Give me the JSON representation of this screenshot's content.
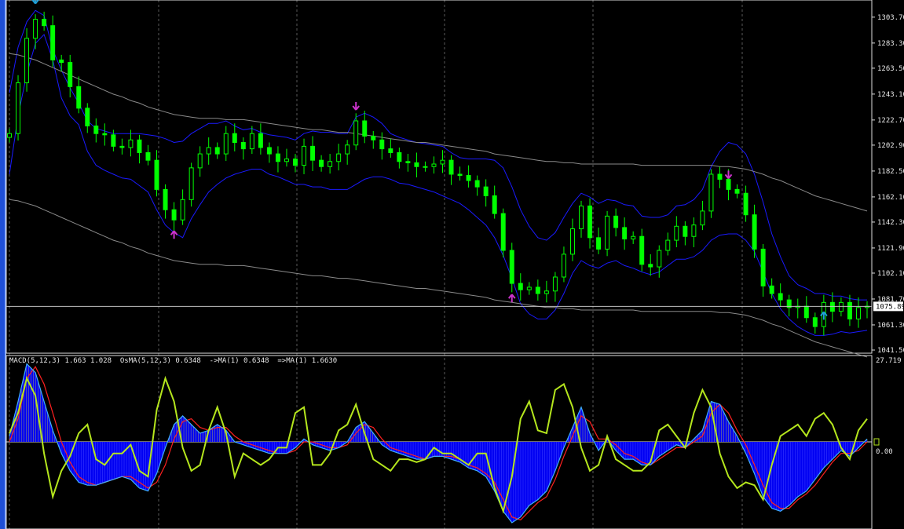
{
  "window": {
    "macd_label": "MACD(5,12,3) 1.663 1.028  OsMA(5,12,3) 0.6348  ->MA(1) 0.6348  =>MA(1) 1.6630"
  },
  "colors": {
    "background": "#000000",
    "candle_up": "#00ff00",
    "bollinger": "#1a1aff",
    "long_band": "#8a8a8a",
    "arrow_sell": "#cc33cc",
    "arrow_buy": "#1f9fd6",
    "osma_fill": "#0000ff",
    "macd_signal": "#ff2020",
    "macd_line": "#3fb0ff",
    "oscillator": "#b5e61d",
    "axis_text": "#e8e8e8"
  },
  "chart_data": [
    {
      "type": "line",
      "name": "price-panel",
      "ylim": [
        1041.5,
        1313.5
      ],
      "y_ticks": [
        "1303.70",
        "1283.30",
        "1263.50",
        "1243.10",
        "1222.70",
        "1202.90",
        "1182.50",
        "1162.10",
        "1142.30",
        "1121.90",
        "1102.10",
        "1081.70",
        "1061.30",
        "1041.50"
      ],
      "y_tick_values": [
        1303.7,
        1283.3,
        1263.5,
        1243.1,
        1222.7,
        1202.9,
        1182.5,
        1162.1,
        1142.3,
        1121.9,
        1102.1,
        1081.7,
        1061.3,
        1041.5
      ],
      "current_price": "1075.89",
      "current_price_value": 1075.89,
      "grid": "vertical-dotted",
      "series": [
        {
          "values": [
            1212,
            1252,
            1287,
            1302,
            1297,
            1270,
            1268,
            1249,
            1232,
            1218,
            1212,
            1211,
            1202,
            1201,
            1207,
            1197,
            1191,
            1168,
            1152,
            1144,
            1160,
            1185,
            1196,
            1201,
            1196,
            1212,
            1205,
            1200,
            1212,
            1201,
            1196,
            1190,
            1192,
            1187,
            1202,
            1191,
            1186,
            1190,
            1196,
            1203,
            1222,
            1210,
            1207,
            1200,
            1197,
            1190,
            1189,
            1186,
            1186,
            1188,
            1191,
            1180,
            1179,
            1175,
            1170,
            1163,
            1149,
            1120,
            1094,
            1089,
            1091,
            1086,
            1088,
            1099,
            1117,
            1137,
            1155,
            1130,
            1121,
            1147,
            1138,
            1129,
            1131,
            1109,
            1107,
            1120,
            1128,
            1139,
            1131,
            1140,
            1151,
            1180,
            1176,
            1168,
            1165,
            1148,
            1121,
            1092,
            1086,
            1081,
            1075,
            1076,
            1067,
            1060,
            1079,
            1072,
            1079,
            1066,
            1075,
            1076
          ]
        },
        {
          "values": [
            1244,
            1280,
            1300,
            1309,
            1305,
            1278,
            1262,
            1248,
            1236,
            1222,
            1216,
            1214,
            1212,
            1212,
            1212,
            1212,
            1211,
            1210,
            1208,
            1205,
            1206,
            1212,
            1216,
            1220,
            1220,
            1222,
            1218,
            1215,
            1216,
            1213,
            1211,
            1210,
            1209,
            1207,
            1212,
            1214,
            1213,
            1213,
            1212,
            1212,
            1225,
            1228,
            1225,
            1220,
            1212,
            1209,
            1207,
            1205,
            1204,
            1203,
            1202,
            1197,
            1193,
            1192,
            1192,
            1192,
            1191,
            1185,
            1170,
            1152,
            1139,
            1130,
            1128,
            1134,
            1146,
            1157,
            1165,
            1162,
            1157,
            1160,
            1159,
            1156,
            1155,
            1147,
            1146,
            1146,
            1148,
            1155,
            1156,
            1160,
            1168,
            1186,
            1198,
            1205,
            1203,
            1196,
            1180,
            1158,
            1133,
            1115,
            1100,
            1093,
            1090,
            1086,
            1086,
            1084,
            1084,
            1082,
            1081,
            1081
          ]
        },
        {
          "values": [
            1180,
            1226,
            1259,
            1283,
            1290,
            1270,
            1240,
            1226,
            1219,
            1198,
            1187,
            1183,
            1180,
            1177,
            1176,
            1171,
            1166,
            1152,
            1140,
            1134,
            1130,
            1145,
            1156,
            1166,
            1172,
            1177,
            1180,
            1182,
            1184,
            1184,
            1180,
            1178,
            1175,
            1172,
            1172,
            1170,
            1170,
            1168,
            1168,
            1168,
            1172,
            1176,
            1178,
            1178,
            1176,
            1173,
            1172,
            1170,
            1168,
            1166,
            1163,
            1160,
            1157,
            1152,
            1146,
            1140,
            1130,
            1116,
            1098,
            1078,
            1070,
            1066,
            1066,
            1073,
            1086,
            1102,
            1112,
            1108,
            1106,
            1110,
            1112,
            1108,
            1106,
            1103,
            1101,
            1103,
            1108,
            1113,
            1113,
            1115,
            1120,
            1128,
            1132,
            1133,
            1133,
            1128,
            1119,
            1103,
            1086,
            1074,
            1066,
            1060,
            1056,
            1053,
            1053,
            1054,
            1056,
            1055,
            1056,
            1057
          ]
        },
        {
          "values": [
            1275,
            1274,
            1272,
            1270,
            1267,
            1264,
            1261,
            1258,
            1255,
            1252,
            1249,
            1246,
            1243,
            1241,
            1238,
            1236,
            1233,
            1231,
            1229,
            1227,
            1226,
            1225,
            1224,
            1224,
            1224,
            1223,
            1223,
            1223,
            1222,
            1221,
            1220,
            1219,
            1218,
            1217,
            1216,
            1215,
            1215,
            1214,
            1213,
            1213,
            1212,
            1211,
            1210,
            1209,
            1208,
            1207,
            1206,
            1205,
            1205,
            1204,
            1203,
            1202,
            1201,
            1200,
            1199,
            1198,
            1196,
            1195,
            1194,
            1193,
            1192,
            1191,
            1190,
            1190,
            1189,
            1189,
            1188,
            1188,
            1188,
            1188,
            1188,
            1188,
            1188,
            1187,
            1187,
            1187,
            1187,
            1187,
            1187,
            1187,
            1187,
            1187,
            1186,
            1186,
            1185,
            1184,
            1182,
            1180,
            1177,
            1175,
            1172,
            1169,
            1166,
            1163,
            1161,
            1159,
            1157,
            1155,
            1153,
            1151
          ]
        }
      ]
    },
    {
      "type": "area",
      "name": "macd-panel",
      "ylim": [
        -29,
        27.719
      ],
      "y_ticks": [
        "27.719",
        "0.00"
      ],
      "y_tick_values": [
        27.719,
        0
      ],
      "macd": {
        "values": [
          2,
          14,
          27,
          24,
          14,
          4,
          -4,
          -10,
          -14,
          -15,
          -15,
          -14,
          -13,
          -12,
          -13,
          -16,
          -17,
          -11,
          -2,
          6,
          9,
          6,
          3,
          4,
          6,
          4,
          0,
          -1,
          -2,
          -3,
          -4,
          -4,
          -4,
          -2,
          1,
          -1,
          -2,
          -3,
          -2,
          0,
          5,
          7,
          3,
          -1,
          -3,
          -4,
          -5,
          -6,
          -6,
          -5,
          -5,
          -6,
          -7,
          -9,
          -10,
          -12,
          -17,
          -24,
          -28,
          -26,
          -22,
          -20,
          -17,
          -10,
          -2,
          5,
          12,
          3,
          -3,
          1,
          -3,
          -6,
          -6,
          -8,
          -8,
          -5,
          -3,
          -1,
          -2,
          1,
          4,
          14,
          13,
          7,
          2,
          -4,
          -11,
          -19,
          -23,
          -24,
          -22,
          -19,
          -17,
          -13,
          -9,
          -6,
          -3,
          -5,
          -2,
          1
        ]
      },
      "signal": {
        "values": [
          0,
          8,
          22,
          26,
          20,
          10,
          0,
          -7,
          -12,
          -14,
          -15,
          -14,
          -13,
          -12,
          -12,
          -14,
          -16,
          -14,
          -8,
          1,
          7,
          8,
          5,
          4,
          5,
          5,
          2,
          0,
          -1,
          -2,
          -3,
          -4,
          -4,
          -3,
          0,
          0,
          -1,
          -2,
          -2,
          -1,
          3,
          6,
          5,
          1,
          -2,
          -3,
          -4,
          -5,
          -6,
          -5,
          -5,
          -5,
          -6,
          -8,
          -9,
          -11,
          -14,
          -20,
          -26,
          -27,
          -24,
          -21,
          -19,
          -13,
          -5,
          2,
          9,
          7,
          1,
          1,
          -1,
          -4,
          -5,
          -7,
          -8,
          -6,
          -4,
          -2,
          -2,
          0,
          2,
          10,
          13,
          10,
          4,
          -1,
          -8,
          -15,
          -21,
          -23,
          -23,
          -20,
          -18,
          -15,
          -11,
          -7,
          -4,
          -4,
          -3,
          0
        ]
      },
      "oscillator": {
        "values": [
          3,
          10,
          22,
          16,
          -4,
          -19,
          -10,
          -5,
          3,
          6,
          -6,
          -8,
          -4,
          -4,
          -1,
          -10,
          -12,
          11,
          22,
          14,
          -2,
          -10,
          -8,
          4,
          12,
          3,
          -12,
          -4,
          -6,
          -8,
          -6,
          -2,
          -2,
          10,
          12,
          -8,
          -8,
          -4,
          4,
          6,
          13,
          3,
          -6,
          -8,
          -10,
          -6,
          -6,
          -7,
          -6,
          -2,
          -4,
          -4,
          -6,
          -8,
          -4,
          -4,
          -16,
          -24,
          -12,
          8,
          14,
          4,
          3,
          18,
          20,
          12,
          -2,
          -10,
          -8,
          2,
          -6,
          -8,
          -10,
          -10,
          -7,
          4,
          6,
          2,
          -2,
          10,
          18,
          12,
          -4,
          -12,
          -16,
          -14,
          -15,
          -20,
          -8,
          2,
          4,
          6,
          2,
          8,
          10,
          6,
          -2,
          -6,
          4,
          8
        ]
      },
      "osma": {
        "values": [
          1,
          6,
          5,
          -2,
          -6,
          -6,
          -4,
          -3,
          -2,
          -1,
          0,
          0,
          0,
          0,
          -1,
          -2,
          -1,
          3,
          6,
          5,
          2,
          -2,
          -2,
          0,
          1,
          -1,
          -2,
          -1,
          -1,
          -1,
          -1,
          0,
          0,
          1,
          1,
          -1,
          -1,
          -1,
          0,
          1,
          2,
          1,
          -2,
          -2,
          -1,
          -1,
          -1,
          -1,
          0,
          0,
          0,
          -1,
          -1,
          -1,
          -1,
          -1,
          -3,
          -4,
          -2,
          1,
          2,
          1,
          2,
          3,
          3,
          3,
          3,
          -4,
          -4,
          0,
          -2,
          -2,
          -1,
          -1,
          0,
          1,
          1,
          1,
          0,
          1,
          2,
          4,
          0,
          -3,
          -2,
          -3,
          -3,
          -4,
          -2,
          -1,
          1,
          1,
          1,
          2,
          2,
          1,
          1,
          -1,
          1,
          1
        ]
      }
    }
  ]
}
